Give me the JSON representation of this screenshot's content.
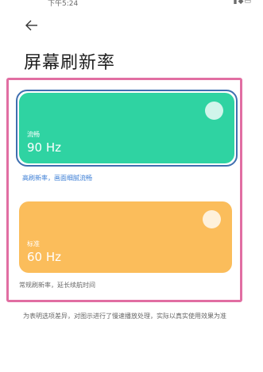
{
  "status_bar": {
    "time": "下午5:24",
    "icons": [
      "wechat-icon",
      "image-icon",
      "app-icon",
      "signal-icon",
      "wifi-icon",
      "battery-icon"
    ]
  },
  "header": {
    "back_icon": "arrow-left-icon",
    "title": "屏幕刷新率"
  },
  "options": [
    {
      "name": "流畅",
      "rate": "90 Hz",
      "description": "高刷新率，画面细腻流畅",
      "selected": true,
      "color": "#2fd3a2"
    },
    {
      "name": "标准",
      "rate": "60 Hz",
      "description": "常规刷新率，延长续航时间",
      "selected": false,
      "color": "#fbbd5b"
    }
  ],
  "footnote": "为表明选项差异，对图示进行了慢速播放处理，实际以真实使用效果为准",
  "colors": {
    "highlight_frame": "#e16ea2",
    "selected_outline": "#3f6fb0",
    "selected_desc": "#3d7fd6"
  }
}
